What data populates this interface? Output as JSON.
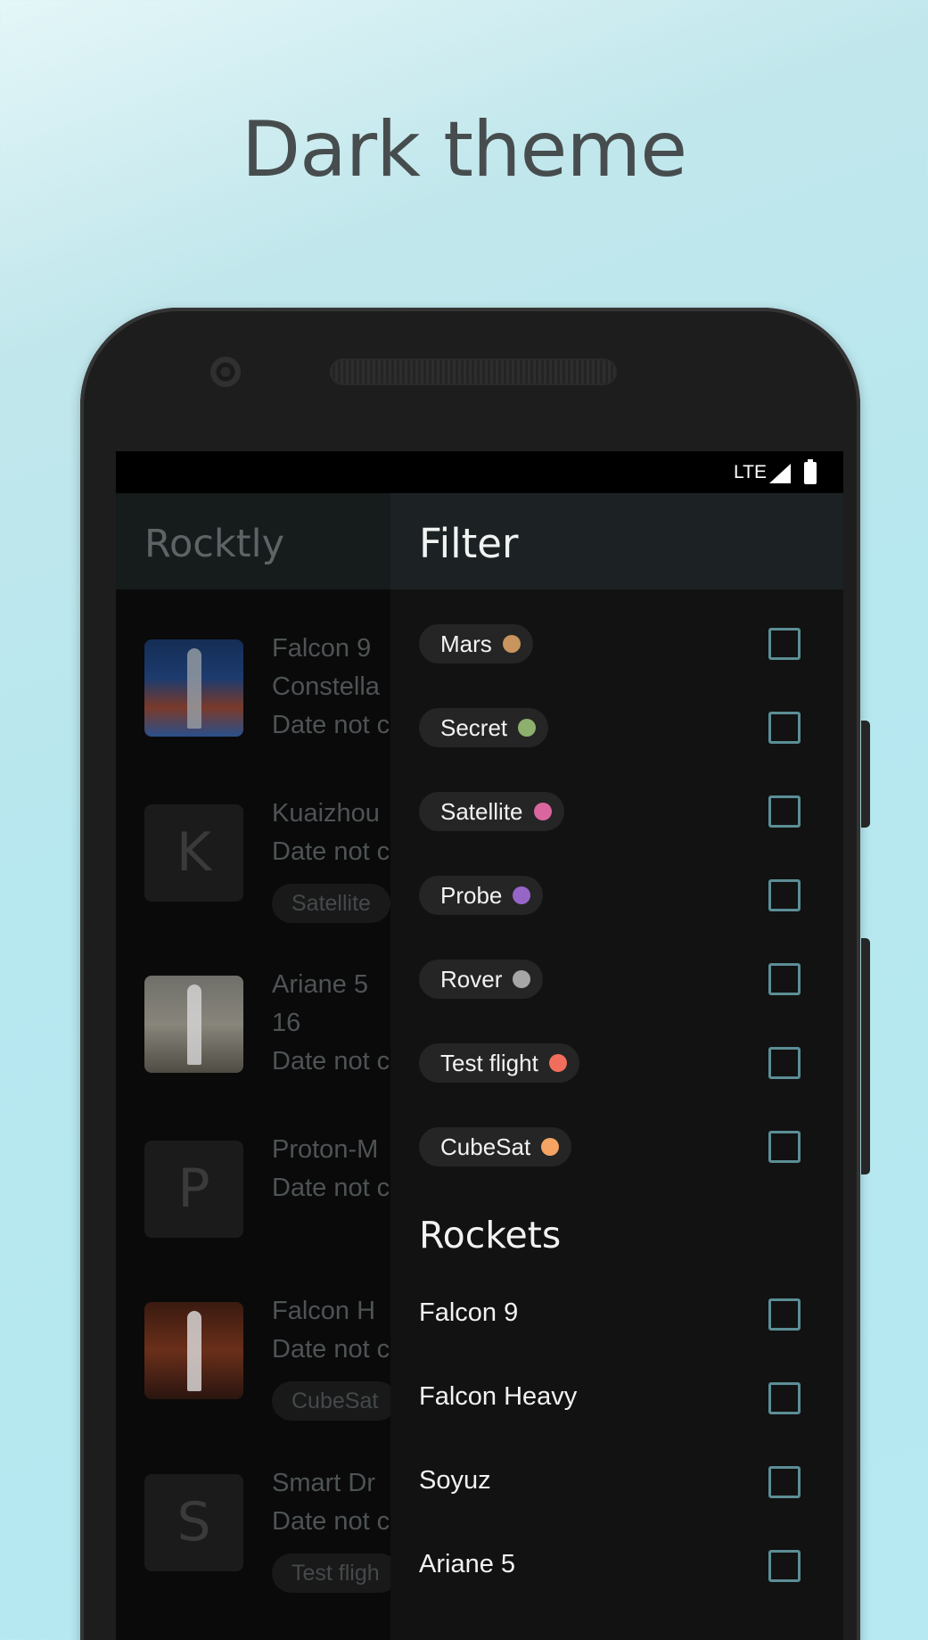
{
  "headline": "Dark theme",
  "status_bar": {
    "network": "LTE"
  },
  "app": {
    "title": "Rocktly"
  },
  "list": [
    {
      "thumb": "",
      "lines": [
        "Falcon 9",
        "Constella",
        "Date not c"
      ],
      "chip": ""
    },
    {
      "thumb": "K",
      "lines": [
        "Kuaizhou",
        "Date not c"
      ],
      "chip": "Satellite"
    },
    {
      "thumb": "",
      "lines": [
        "Ariane 5",
        "16",
        "Date not c"
      ],
      "chip": ""
    },
    {
      "thumb": "P",
      "lines": [
        "Proton-M",
        "Date not c"
      ],
      "chip": ""
    },
    {
      "thumb": "",
      "lines": [
        "Falcon H",
        "Date not c"
      ],
      "chip": "CubeSat"
    },
    {
      "thumb": "S",
      "lines": [
        "Smart Dr",
        "Date not c"
      ],
      "chip": "Test fligh"
    }
  ],
  "filter": {
    "title": "Filter",
    "tags": [
      {
        "label": "Mars",
        "color": "#c8955e"
      },
      {
        "label": "Secret",
        "color": "#8eb06e"
      },
      {
        "label": "Satellite",
        "color": "#d9669e"
      },
      {
        "label": "Probe",
        "color": "#9566c8"
      },
      {
        "label": "Rover",
        "color": "#a6a6a6"
      },
      {
        "label": "Test flight",
        "color": "#f16e5c"
      },
      {
        "label": "CubeSat",
        "color": "#f5a463"
      }
    ],
    "rockets_title": "Rockets",
    "rockets": [
      "Falcon 9",
      "Falcon Heavy",
      "Soyuz",
      "Ariane 5"
    ]
  },
  "colors": {
    "accent_checkbox": "#5b8e96",
    "drawer_bg": "#121212",
    "appbar_bg": "#1c2223"
  }
}
